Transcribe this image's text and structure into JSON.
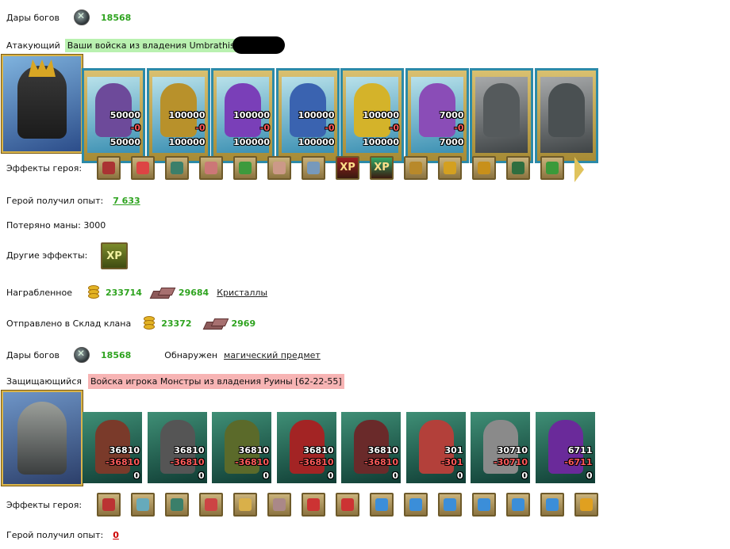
{
  "gifts_label": "Дары богов",
  "gifts_value": "18568",
  "attacker": {
    "label": "Атакующий",
    "army_text": "Ваши войска из владения Umbrathis"
  },
  "attacker_units": [
    {
      "count": "50000",
      "loss": "-0",
      "remain": "50000",
      "color": "#6d4a9a"
    },
    {
      "count": "100000",
      "loss": "-0",
      "remain": "100000",
      "color": "#b8912b"
    },
    {
      "count": "100000",
      "loss": "-0",
      "remain": "100000",
      "color": "#7a3fb8"
    },
    {
      "count": "100000",
      "loss": "-0",
      "remain": "100000",
      "color": "#3a63b0"
    },
    {
      "count": "100000",
      "loss": "-0",
      "remain": "100000",
      "color": "#d4b32a"
    },
    {
      "count": "7000",
      "loss": "-0",
      "remain": "7000",
      "color": "#8a4db7"
    },
    {
      "count": "",
      "loss": "",
      "remain": "",
      "color": "#555a5c"
    },
    {
      "count": "",
      "loss": "",
      "remain": "",
      "color": "#4a5052"
    }
  ],
  "hero_effects_label": "Эффекты героя:",
  "attacker_effects": [
    {
      "icon": "horn-icon",
      "color": "#a33"
    },
    {
      "icon": "dice-icon",
      "color": "#d44"
    },
    {
      "icon": "shield-icon",
      "color": "#3b7f6a"
    },
    {
      "icon": "fist-shield-icon",
      "color": "#c77"
    },
    {
      "icon": "sword-icon",
      "color": "#3d9a3d"
    },
    {
      "icon": "hand-sword-icon",
      "color": "#c98"
    },
    {
      "icon": "hand-icon",
      "color": "#79b"
    },
    {
      "icon": "xp-icon",
      "color": "#9b2020",
      "text": "XP"
    },
    {
      "icon": "xp-clover-icon",
      "color": "#3a6",
      "text": "XP"
    },
    {
      "icon": "claw-icon",
      "color": "#b8892a"
    },
    {
      "icon": "cross-icon",
      "color": "#d4a020"
    },
    {
      "icon": "sun-icon",
      "color": "#c8901a"
    },
    {
      "icon": "helmet-icon",
      "color": "#2f6e3f"
    },
    {
      "icon": "gem-icon",
      "color": "#3a9a3a"
    }
  ],
  "exp_label": "Герой получил опыт:",
  "attacker_exp": "7 633",
  "mana_text": "Потеряно маны: 3000",
  "other_effects_label": "Другие эффекты:",
  "other_effect": {
    "icon": "xp-icon",
    "text": "XP"
  },
  "looted": {
    "label": "Награбленное",
    "gold": "233714",
    "crystals": "29684",
    "crystals_link": "Кристаллы"
  },
  "clan": {
    "label": "Отправлено в Склад клана",
    "gold": "23372",
    "crystals": "2969"
  },
  "found": {
    "label": "Обнаружен",
    "item": "магический предмет"
  },
  "defender": {
    "label": "Защищающийся",
    "army_text": "Войска игрока Монстры из владения Руины [62-22-55]"
  },
  "defender_units": [
    {
      "count": "36810",
      "loss": "-36810",
      "remain": "0",
      "color": "#7a3a2a"
    },
    {
      "count": "36810",
      "loss": "-36810",
      "remain": "0",
      "color": "#555"
    },
    {
      "count": "36810",
      "loss": "-36810",
      "remain": "0",
      "color": "#5b6a2a"
    },
    {
      "count": "36810",
      "loss": "-36810",
      "remain": "0",
      "color": "#a32424"
    },
    {
      "count": "36810",
      "loss": "-36810",
      "remain": "0",
      "color": "#6a2a2a"
    },
    {
      "count": "301",
      "loss": "-301",
      "remain": "0",
      "color": "#b3403a"
    },
    {
      "count": "30710",
      "loss": "-30710",
      "remain": "0",
      "color": "#8a8a8a"
    },
    {
      "count": "6711",
      "loss": "-6711",
      "remain": "0",
      "color": "#6a2a9a"
    }
  ],
  "defender_effects": [
    {
      "icon": "helmet-icon",
      "color": "#b33"
    },
    {
      "icon": "spear-icon",
      "color": "#6ab"
    },
    {
      "icon": "shield-icon",
      "color": "#3b7f6a"
    },
    {
      "icon": "tower-icon",
      "color": "#c44"
    },
    {
      "icon": "skull-icon",
      "color": "#d9b04a"
    },
    {
      "icon": "crossbow-icon",
      "color": "#a88"
    },
    {
      "icon": "no-icon",
      "color": "#c33"
    },
    {
      "icon": "claw-icon",
      "color": "#c33"
    },
    {
      "icon": "frost-icon",
      "color": "#3b8ed9"
    },
    {
      "icon": "armor-icon",
      "color": "#3b8ed9"
    },
    {
      "icon": "ring-icon",
      "color": "#3b8ed9"
    },
    {
      "icon": "ice-bow-icon",
      "color": "#3b8ed9"
    },
    {
      "icon": "staff-icon",
      "color": "#3b8ed9"
    },
    {
      "icon": "ice-star-icon",
      "color": "#3b8ed9"
    },
    {
      "icon": "fire-star-icon",
      "color": "#e0a020"
    }
  ],
  "defender_exp": "0"
}
